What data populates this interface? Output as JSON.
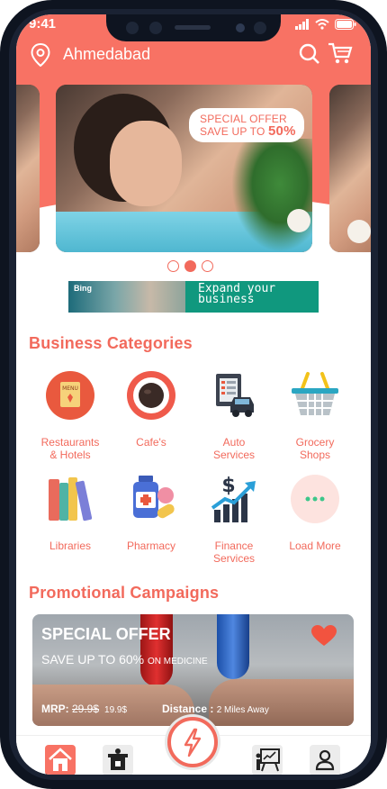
{
  "status_bar": {
    "time": "9:41"
  },
  "header": {
    "location": "Ahmedabad"
  },
  "carousel": {
    "slides_count": 3,
    "active_index": 1,
    "offer_line1": "SPECIAL OFFER",
    "offer_line2": "SAVE UP TO ",
    "offer_percent": "50%"
  },
  "ad": {
    "brand": "Bing",
    "text_line1": "Expand your",
    "text_line2": "business"
  },
  "categories": {
    "title": "Business Categories",
    "items": [
      {
        "label1": "Restaurants",
        "label2": "& Hotels",
        "icon": "menu-icon"
      },
      {
        "label1": "Cafe's",
        "label2": "",
        "icon": "coffee-cup-icon"
      },
      {
        "label1": "Auto",
        "label2": "Services",
        "icon": "car-service-icon"
      },
      {
        "label1": "Grocery",
        "label2": "Shops",
        "icon": "basket-icon"
      },
      {
        "label1": "Libraries",
        "label2": "",
        "icon": "books-icon"
      },
      {
        "label1": "Pharmacy",
        "label2": "",
        "icon": "medicine-icon"
      },
      {
        "label1": "Finance",
        "label2": "Services",
        "icon": "finance-chart-icon"
      },
      {
        "label1": "Load More",
        "label2": "",
        "icon": "more-dots-icon"
      }
    ]
  },
  "promotions": {
    "title": "Promotional Campaigns",
    "card": {
      "headline": "SPECIAL OFFER",
      "subline": "SAVE UP TO 60% ",
      "subline_small": "ON MEDICINE",
      "mrp_label": "MRP: ",
      "old_price": "29.9$",
      "new_price": "19.9$",
      "distance_label": "Distance : ",
      "distance_value": "2 Miles Away"
    }
  },
  "colors": {
    "accent": "#f26a5c",
    "header": "#f87264",
    "ad_green": "#10987e"
  }
}
